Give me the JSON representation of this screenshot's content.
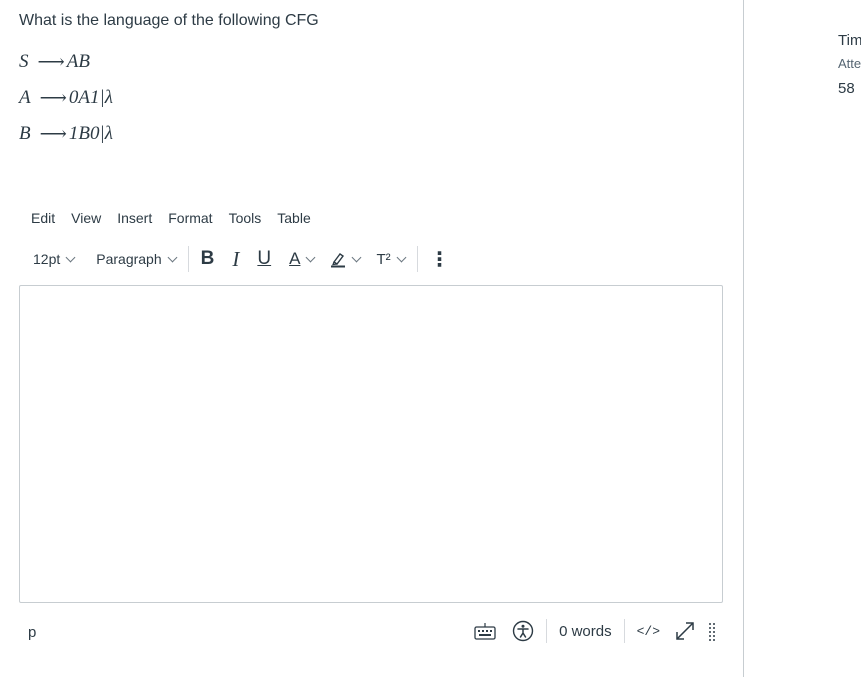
{
  "question": {
    "prompt": "What is the language of the following CFG",
    "rules": [
      {
        "lhs": "S",
        "arrow": "⟶",
        "rhs": "AB"
      },
      {
        "lhs": "A",
        "arrow": "⟶",
        "rhs": "0A1|λ"
      },
      {
        "lhs": "B",
        "arrow": "⟶",
        "rhs": "1B0|λ"
      }
    ]
  },
  "editor": {
    "menu": [
      "Edit",
      "View",
      "Insert",
      "Format",
      "Tools",
      "Table"
    ],
    "font_size": "12pt",
    "block_format": "Paragraph",
    "bold_label": "B",
    "italic_label": "I",
    "underline_label": "U",
    "text_color_label": "A",
    "superscript_label": "T²",
    "more_label": "⋮",
    "content": "",
    "path": "p",
    "word_count": "0 words",
    "html_toggle": "</>"
  },
  "sidebar": {
    "time_label": "Tim",
    "attempt_label": "Atte",
    "value": "58"
  },
  "icons": [
    "keyboard-icon",
    "accessibility-icon",
    "code-icon",
    "fullscreen-icon",
    "drag-handle-icon",
    "highlight-icon",
    "chevron-down-icon"
  ]
}
